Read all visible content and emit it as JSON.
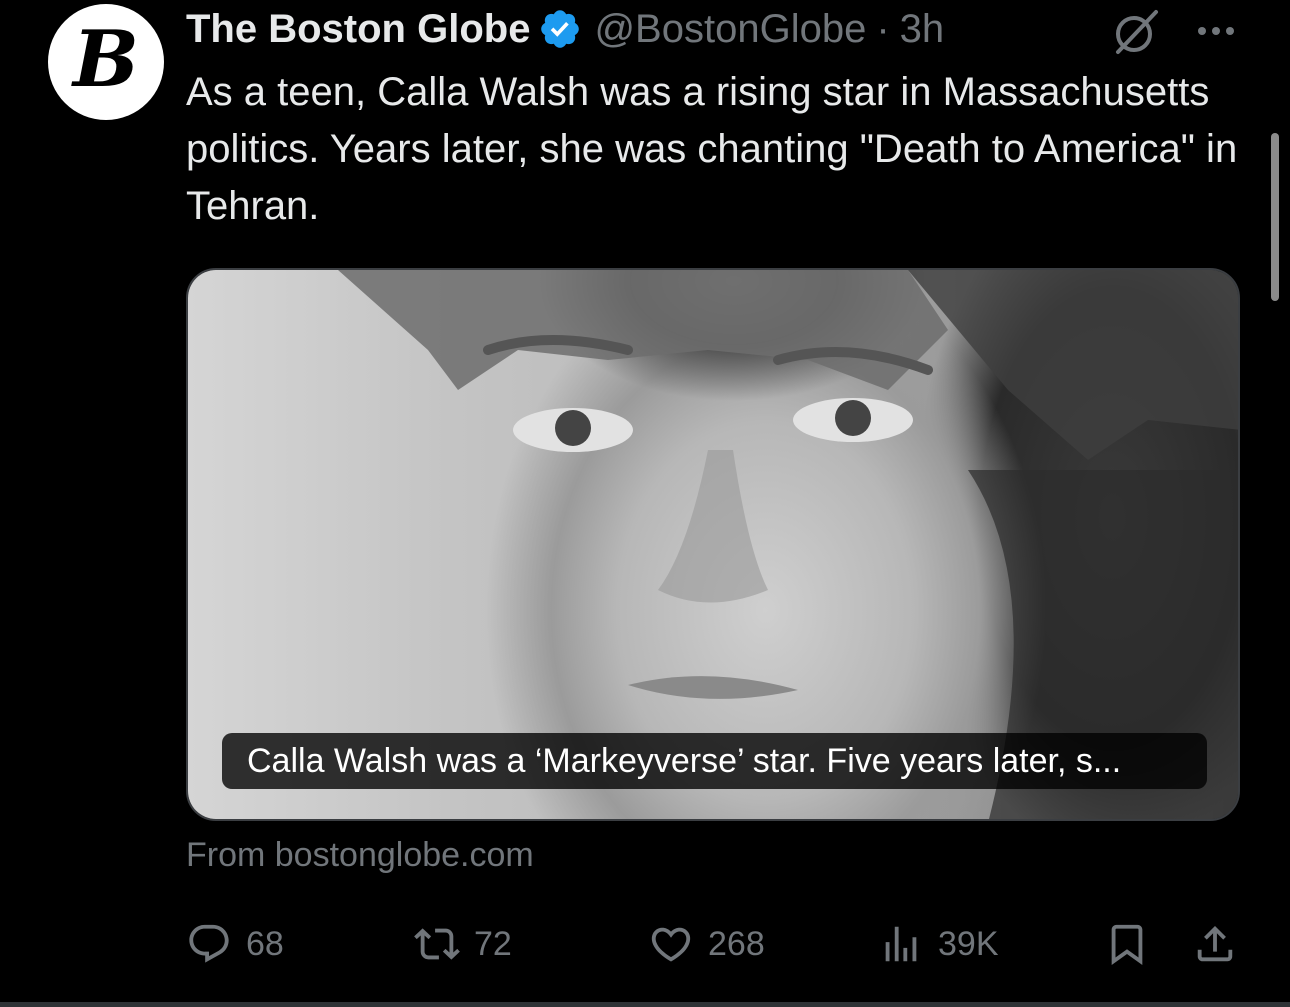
{
  "author": {
    "display_name": "The Boston Globe",
    "handle": "@BostonGlobe",
    "separator": "·",
    "time": "3h",
    "avatar_letter": "B",
    "verified_color": "#1d9bf0"
  },
  "tweet": {
    "text": "As a teen, Calla Walsh was a rising star in Massachusetts politics. Years later, she was chanting \"Death to America\" in Tehran."
  },
  "card": {
    "caption": "Calla Walsh was a ‘Markeyverse’ star. Five years later, s...",
    "source": "From bostonglobe.com"
  },
  "actions": {
    "replies": "68",
    "retweets": "72",
    "likes": "268",
    "views": "39K"
  },
  "colors": {
    "background": "#000000",
    "text_primary": "#e7e9ea",
    "text_secondary": "#71767b",
    "border": "#3b3e42"
  },
  "icons": [
    "verified-badge-icon",
    "grok-icon",
    "more-icon",
    "reply-icon",
    "retweet-icon",
    "like-icon",
    "views-icon",
    "bookmark-icon",
    "share-icon"
  ]
}
